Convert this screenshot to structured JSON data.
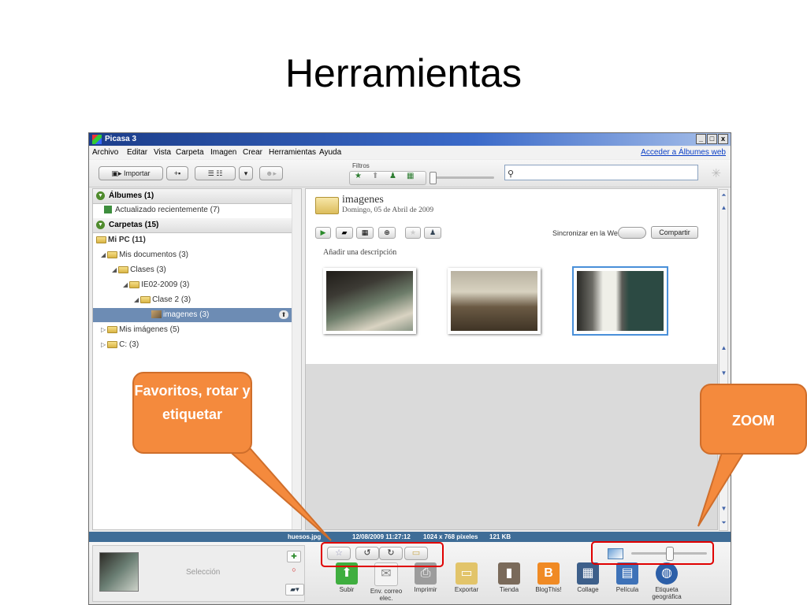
{
  "slide_title": "Herramientas",
  "window": {
    "title": "Picasa 3",
    "min": "_",
    "max": "□",
    "close": "x",
    "web_link": "Acceder a Álbumes web"
  },
  "menu": [
    "Archivo",
    "Editar",
    "Vista",
    "Carpeta",
    "Imagen",
    "Crear",
    "Herramientas",
    "Ayuda"
  ],
  "toolbar": {
    "import_label": "Importar",
    "filters_label": "Filtros",
    "search_placeholder": ""
  },
  "library": {
    "albums_header": "Álbumes (1)",
    "recent": "Actualizado recientemente (7)",
    "folders_header": "Carpetas (15)",
    "tree": [
      {
        "label": "Mi PC (11)",
        "bold": true
      },
      {
        "label": "Mis documentos (3)"
      },
      {
        "label": "Clases (3)"
      },
      {
        "label": "IE02-2009 (3)"
      },
      {
        "label": "Clase 2 (3)"
      },
      {
        "label": "imagenes (3)",
        "selected": true
      },
      {
        "label": "Mis imágenes (5)"
      },
      {
        "label": "C: (3)"
      }
    ]
  },
  "album": {
    "title": "imagenes",
    "date": "Domingo, 05 de Abril de 2009",
    "sync_label": "Sincronizar en la Web",
    "share_label": "Compartir",
    "add_description": "Añadir una descripción"
  },
  "status": {
    "file": "huesos.jpg",
    "date": "12/08/2009 11:27:12",
    "dimensions": "1024 x 768 píxeles",
    "size": "121 KB"
  },
  "tray": {
    "selection_label": "Selección"
  },
  "actions": [
    {
      "label": "Subir",
      "icon": "upload-icon",
      "color": "#3fae3f"
    },
    {
      "label": "Env. correo elec.",
      "icon": "email-icon",
      "color": "#e6e6e6"
    },
    {
      "label": "Imprimir",
      "icon": "printer-icon",
      "color": "#9c9c9c"
    },
    {
      "label": "Exportar",
      "icon": "folder-icon",
      "color": "#e2c46a"
    },
    {
      "label": "Tienda",
      "icon": "shop-icon",
      "color": "#7a6a5a"
    },
    {
      "label": "BlogThis!",
      "icon": "blogger-icon",
      "color": "#f08a24"
    },
    {
      "label": "Collage",
      "icon": "collage-icon",
      "color": "#3d5f8a"
    },
    {
      "label": "Película",
      "icon": "movie-icon",
      "color": "#3e72b8"
    },
    {
      "label": "Etiqueta geográfica",
      "icon": "globe-icon",
      "color": "#2c5fa8"
    }
  ],
  "callouts": {
    "left": "Favoritos, rotar y etiquetar",
    "right": "ZOOM"
  },
  "colors": {
    "callout": "#f48a3d",
    "highlight": "#e00000",
    "statusbar": "#3f6d97",
    "selection": "#6d8cb4"
  }
}
